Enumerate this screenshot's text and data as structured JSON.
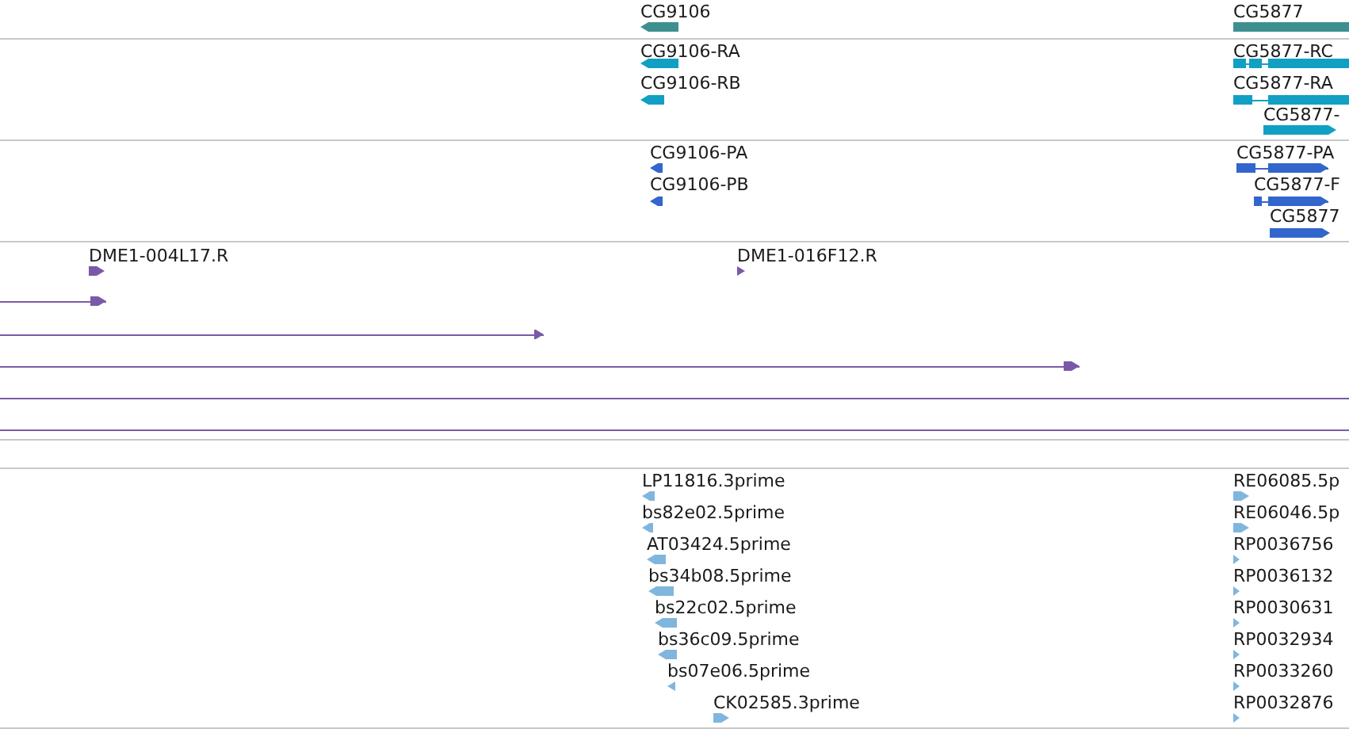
{
  "tracks": [
    {
      "kind": "gene",
      "features": [
        {
          "label": "CG9106",
          "reverse": true
        },
        {
          "label": "CG5877",
          "reverse": false
        }
      ]
    },
    {
      "kind": "transcript",
      "features": [
        {
          "label": "CG9106-RA",
          "reverse": true
        },
        {
          "label": "CG9106-RB",
          "reverse": true
        },
        {
          "label": "CG5877-RC",
          "reverse": false
        },
        {
          "label": "CG5877-RA",
          "reverse": false
        },
        {
          "label": "CG5877-",
          "reverse": false
        }
      ]
    },
    {
      "kind": "protein",
      "features": [
        {
          "label": "CG9106-PA",
          "reverse": true
        },
        {
          "label": "CG9106-PB",
          "reverse": true
        },
        {
          "label": "CG5877-PA",
          "reverse": false
        },
        {
          "label": "CG5877-F",
          "reverse": false
        },
        {
          "label": "CG5877",
          "reverse": false
        }
      ]
    },
    {
      "kind": "read",
      "features": [
        {
          "kind": "end",
          "label": "DME1-004L17.R",
          "reverse": false
        },
        {
          "kind": "end",
          "label": "DME1-016F12.R",
          "reverse": false
        },
        {
          "kind": "end",
          "reverse": false
        },
        {
          "kind": "end",
          "reverse": false
        },
        {
          "kind": "end",
          "reverse": false
        },
        {
          "kind": "through"
        },
        {
          "kind": "through"
        }
      ]
    },
    {
      "kind": "empty"
    },
    {
      "kind": "est",
      "features": [
        {
          "label": "LP11816.3prime",
          "reverse": true
        },
        {
          "label": "bs82e02.5prime",
          "reverse": true
        },
        {
          "label": "AT03424.5prime",
          "reverse": true
        },
        {
          "label": "bs34b08.5prime",
          "reverse": true
        },
        {
          "label": "bs22c02.5prime",
          "reverse": true
        },
        {
          "label": "bs36c09.5prime",
          "reverse": true
        },
        {
          "label": "bs07e06.5prime",
          "reverse": true
        },
        {
          "label": "CK02585.3prime",
          "reverse": false
        },
        {
          "label": "RE06085.5p",
          "reverse": false
        },
        {
          "label": "RE06046.5p",
          "reverse": false
        },
        {
          "label": "RP0036756",
          "reverse": false
        },
        {
          "label": "RP0036132",
          "reverse": false
        },
        {
          "label": "RP0030631",
          "reverse": false
        },
        {
          "label": "RP0032934",
          "reverse": false
        },
        {
          "label": "RP0033260",
          "reverse": false
        },
        {
          "label": "RP0032876",
          "reverse": false
        }
      ]
    }
  ]
}
